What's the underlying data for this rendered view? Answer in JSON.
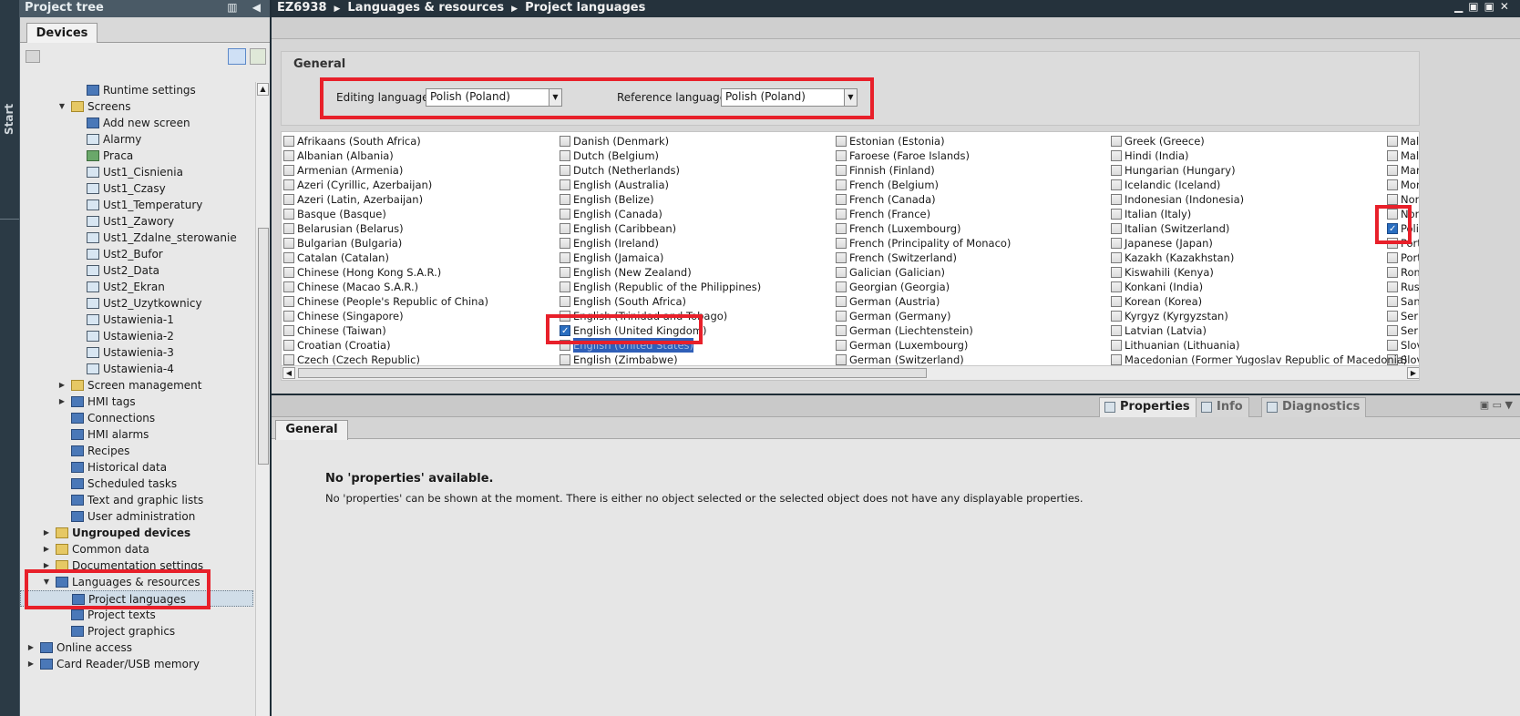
{
  "start_strip": {
    "label": "Start"
  },
  "project_tree": {
    "title": "Project tree",
    "devices_tab": "Devices",
    "items": [
      {
        "label": "Runtime settings",
        "indent": 3,
        "exp": "",
        "icon": "wrench-icon"
      },
      {
        "label": "Screens",
        "indent": 2,
        "exp": "open",
        "icon": "folder-icon"
      },
      {
        "label": "Add new screen",
        "indent": 3,
        "exp": "",
        "icon": "add-screen-icon"
      },
      {
        "label": "Alarmy",
        "indent": 3,
        "exp": "",
        "icon": "screen-icon"
      },
      {
        "label": "Praca",
        "indent": 3,
        "exp": "",
        "icon": "start-screen-icon"
      },
      {
        "label": "Ust1_Cisnienia",
        "indent": 3,
        "exp": "",
        "icon": "screen-icon"
      },
      {
        "label": "Ust1_Czasy",
        "indent": 3,
        "exp": "",
        "icon": "screen-icon"
      },
      {
        "label": "Ust1_Temperatury",
        "indent": 3,
        "exp": "",
        "icon": "screen-icon"
      },
      {
        "label": "Ust1_Zawory",
        "indent": 3,
        "exp": "",
        "icon": "screen-icon"
      },
      {
        "label": "Ust1_Zdalne_sterowanie",
        "indent": 3,
        "exp": "",
        "icon": "screen-icon"
      },
      {
        "label": "Ust2_Bufor",
        "indent": 3,
        "exp": "",
        "icon": "screen-icon"
      },
      {
        "label": "Ust2_Data",
        "indent": 3,
        "exp": "",
        "icon": "screen-icon"
      },
      {
        "label": "Ust2_Ekran",
        "indent": 3,
        "exp": "",
        "icon": "screen-icon"
      },
      {
        "label": "Ust2_Uzytkownicy",
        "indent": 3,
        "exp": "",
        "icon": "screen-icon"
      },
      {
        "label": "Ustawienia-1",
        "indent": 3,
        "exp": "",
        "icon": "screen-icon"
      },
      {
        "label": "Ustawienia-2",
        "indent": 3,
        "exp": "",
        "icon": "screen-icon"
      },
      {
        "label": "Ustawienia-3",
        "indent": 3,
        "exp": "",
        "icon": "screen-icon"
      },
      {
        "label": "Ustawienia-4",
        "indent": 3,
        "exp": "",
        "icon": "screen-icon"
      },
      {
        "label": "Screen management",
        "indent": 2,
        "exp": "closed",
        "icon": "folder-icon"
      },
      {
        "label": "HMI tags",
        "indent": 2,
        "exp": "closed",
        "icon": "tags-icon"
      },
      {
        "label": "Connections",
        "indent": 2,
        "exp": "",
        "icon": "connections-icon"
      },
      {
        "label": "HMI alarms",
        "indent": 2,
        "exp": "",
        "icon": "alarms-icon"
      },
      {
        "label": "Recipes",
        "indent": 2,
        "exp": "",
        "icon": "recipes-icon"
      },
      {
        "label": "Historical data",
        "indent": 2,
        "exp": "",
        "icon": "historical-data-icon"
      },
      {
        "label": "Scheduled tasks",
        "indent": 2,
        "exp": "",
        "icon": "scheduled-tasks-icon"
      },
      {
        "label": "Text and graphic lists",
        "indent": 2,
        "exp": "",
        "icon": "text-lists-icon"
      },
      {
        "label": "User administration",
        "indent": 2,
        "exp": "",
        "icon": "user-admin-icon"
      },
      {
        "label": "Ungrouped devices",
        "indent": 1,
        "exp": "closed",
        "icon": "folder-icon",
        "bold": true
      },
      {
        "label": "Common data",
        "indent": 1,
        "exp": "closed",
        "icon": "folder-icon"
      },
      {
        "label": "Documentation settings",
        "indent": 1,
        "exp": "closed",
        "icon": "folder-icon"
      },
      {
        "label": "Languages & resources",
        "indent": 1,
        "exp": "open",
        "icon": "globe-icon"
      },
      {
        "label": "Project languages",
        "indent": 2,
        "exp": "",
        "icon": "globe-icon",
        "selected": true
      },
      {
        "label": "Project texts",
        "indent": 2,
        "exp": "",
        "icon": "texts-icon"
      },
      {
        "label": "Project graphics",
        "indent": 2,
        "exp": "",
        "icon": "graphics-icon"
      },
      {
        "label": "Online access",
        "indent": 0,
        "exp": "closed",
        "icon": "online-icon"
      },
      {
        "label": "Card Reader/USB memory",
        "indent": 0,
        "exp": "closed",
        "icon": "usb-icon"
      }
    ]
  },
  "editor": {
    "breadcrumb": [
      "EZ6938",
      "Languages & resources",
      "Project languages"
    ],
    "general_title": "General",
    "editing_language_label": "Editing language:",
    "editing_language_value": "Polish (Poland)",
    "reference_language_label": "Reference language:",
    "reference_language_value": "Polish (Poland)",
    "language_columns": [
      [
        "Afrikaans (South Africa)",
        "Albanian (Albania)",
        "Armenian (Armenia)",
        "Azeri (Cyrillic, Azerbaijan)",
        "Azeri (Latin, Azerbaijan)",
        "Basque (Basque)",
        "Belarusian (Belarus)",
        "Bulgarian (Bulgaria)",
        "Catalan (Catalan)",
        "Chinese (Hong Kong S.A.R.)",
        "Chinese (Macao S.A.R.)",
        "Chinese (People's Republic of China)",
        "Chinese (Singapore)",
        "Chinese (Taiwan)",
        "Croatian (Croatia)",
        "Czech (Czech Republic)"
      ],
      [
        "Danish (Denmark)",
        "Dutch (Belgium)",
        "Dutch (Netherlands)",
        "English (Australia)",
        "English (Belize)",
        "English (Canada)",
        "English (Caribbean)",
        "English (Ireland)",
        "English (Jamaica)",
        "English (New Zealand)",
        "English (Republic of the Philippines)",
        "English (South Africa)",
        "English (Trinidad and Tobago)",
        "English (United Kingdom)",
        "English (United States)",
        "English (Zimbabwe)"
      ],
      [
        "Estonian (Estonia)",
        "Faroese (Faroe Islands)",
        "Finnish (Finland)",
        "French (Belgium)",
        "French (Canada)",
        "French (France)",
        "French (Luxembourg)",
        "French (Principality of Monaco)",
        "French (Switzerland)",
        "Galician (Galician)",
        "Georgian (Georgia)",
        "German (Austria)",
        "German (Germany)",
        "German (Liechtenstein)",
        "German (Luxembourg)",
        "German (Switzerland)"
      ],
      [
        "Greek (Greece)",
        "Hindi (India)",
        "Hungarian (Hungary)",
        "Icelandic (Iceland)",
        "Indonesian (Indonesia)",
        "Italian (Italy)",
        "Italian (Switzerland)",
        "Japanese (Japan)",
        "Kazakh (Kazakhstan)",
        "Kiswahili (Kenya)",
        "Konkani (India)",
        "Korean (Korea)",
        "Kyrgyz (Kyrgyzstan)",
        "Latvian (Latvia)",
        "Lithuanian (Lithuania)",
        "Macedonian (Former Yugoslav Republic of Macedonia)"
      ],
      [
        "Mala",
        "Mala",
        "Mara",
        "Mon",
        "Norv",
        "Norv",
        "Polis",
        "Portu",
        "Portu",
        "Rom",
        "Russ",
        "Sans",
        "Serb",
        "Serb",
        "Slov",
        "Slov"
      ]
    ],
    "checked": [
      "English (United Kingdom)",
      "Polis"
    ],
    "highlighted": [
      "English (United States)"
    ]
  },
  "inspector": {
    "tabs": [
      "Properties",
      "Info",
      "Diagnostics"
    ],
    "general_tab": "General",
    "no_props_title": "No 'properties' available.",
    "no_props_desc": "No 'properties' can be shown at the moment. There is either no object selected or the selected object does not have any displayable properties."
  },
  "colors": {
    "highlight_red": "#e8202a",
    "selection_blue": "#2f5fb8"
  }
}
